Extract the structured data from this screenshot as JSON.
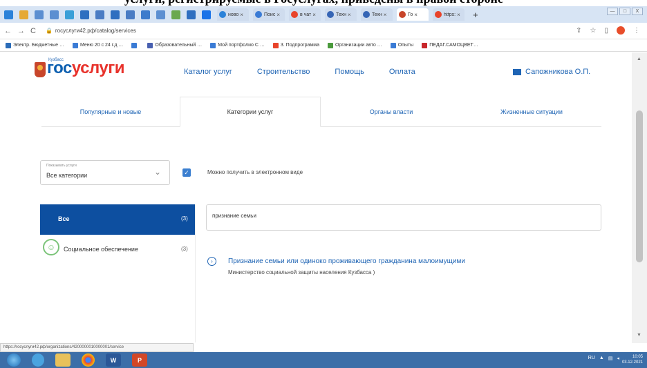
{
  "caption": {
    "text": "услуги, регистрируемые в Госуслугах, приведены в правой стороне"
  },
  "browser": {
    "tabs": [
      {
        "title": "ново",
        "color": "#2b82d9"
      },
      {
        "title": "Поис",
        "color": "#3a7bd5"
      },
      {
        "title": "в чат",
        "color": "#e8432a"
      },
      {
        "title": "Техн",
        "color": "#3565b5"
      },
      {
        "title": "Texн",
        "color": "#3565b5"
      },
      {
        "title": "Го",
        "color": "#c8462b"
      },
      {
        "title": "https:",
        "color": "#e8432a"
      }
    ],
    "new_tab_symbol": "+",
    "window_controls": [
      "—",
      "□",
      "X"
    ],
    "url": "госуслуги42.рф/catalog/services",
    "bookmarks": [
      {
        "label": "Электр. Бюджетные …",
        "color": "#2b6cb8"
      },
      {
        "label": "Меню 20 с 24 г.д …",
        "color": "#3a7bd5"
      },
      {
        "label": "",
        "color": "#3a7bd5"
      },
      {
        "label": "Образовательный …",
        "color": "#4860b0"
      },
      {
        "label": "Мой портфолио С …",
        "color": "#3a7bd5"
      },
      {
        "label": "3. Подпрограмма",
        "color": "#e8432a"
      },
      {
        "label": "Организации авто …",
        "color": "#4a9a3c"
      },
      {
        "label": "Опыты",
        "color": "#3a7bd5"
      },
      {
        "label": "ПЕДАГ.САМОЦВЕТ…",
        "color": "#c8262b"
      }
    ]
  },
  "site": {
    "logo_region": "Кузбасс",
    "logo_gos": "гос",
    "logo_usl": "услуги",
    "nav": [
      "Каталог услуг",
      "Строительство",
      "Помощь",
      "Оплата"
    ],
    "user_name": "Сапожникова О.П."
  },
  "category_tabs": [
    "Популярные и новые",
    "Категории услуг",
    "Органы власти",
    "Жизненные ситуации"
  ],
  "filter": {
    "select_label": "Показывать услуги",
    "select_value": "Все категории",
    "checkbox_label": "Можно получить в электронном виде"
  },
  "categories": [
    {
      "name": "Все",
      "count": "(3)"
    },
    {
      "name": "Социальное обеспечение",
      "count": "(3)"
    }
  ],
  "search": {
    "value": "признание семьи"
  },
  "result": {
    "title": "Признание семьи или одиноко проживающего гражданина малоимущими",
    "subtitle": "Министерство социальной защиты населения Кузбасса )"
  },
  "status_url": "https://госуслуги42.рф/organizations/4200000010000001/service",
  "taskbar": {
    "clock_time": "10:05",
    "clock_date": "03.12.2021"
  }
}
